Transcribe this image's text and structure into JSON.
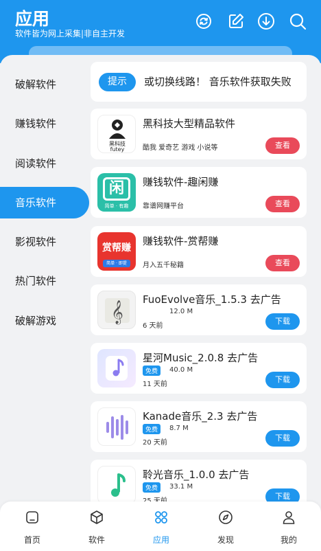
{
  "header": {
    "title": "应用",
    "subtitle": "软件皆为网上采集|非自主开发",
    "icons": [
      "refresh-icon",
      "edit-icon",
      "download-icon",
      "search-icon"
    ]
  },
  "sidebar": {
    "items": [
      {
        "label": "破解软件"
      },
      {
        "label": "赚钱软件"
      },
      {
        "label": "阅读软件"
      },
      {
        "label": "音乐软件",
        "active": true
      },
      {
        "label": "影视软件"
      },
      {
        "label": "热门软件"
      },
      {
        "label": "破解游戏"
      }
    ]
  },
  "tip": {
    "button": "提示",
    "text": "或切换线路！  音乐软件获取失败"
  },
  "promo_cards": [
    {
      "name": "黑科技大型精品软件",
      "desc": "酷我 爱奇艺 游戏 小说等",
      "button": "查看",
      "icon_text": "黑科技",
      "icon_sub": "futey"
    },
    {
      "name": "赚钱软件-趣闲赚",
      "desc": "靠谱网赚平台",
      "button": "查看",
      "icon_text": "闲",
      "icon_sub": "简单 · 有趣"
    },
    {
      "name": "赚钱软件-赏帮赚",
      "desc": "月入五千秘籍",
      "button": "查看",
      "icon_text": "赏帮赚",
      "icon_sub": "简单 · 即提"
    }
  ],
  "app_cards": [
    {
      "name": "FuoEvolve音乐_1.5.3 去广告",
      "size": "12.0 M",
      "age": "6 天前",
      "button": "下载"
    },
    {
      "name": "星河Music_2.0.8 去广告",
      "badge": "免费",
      "size": "40.0 M",
      "age": "11 天前",
      "button": "下载"
    },
    {
      "name": "Kanade音乐_2.3 去广告",
      "badge": "免费",
      "size": "8.7 M",
      "age": "20 天前",
      "button": "下载"
    },
    {
      "name": "聆光音乐_1.0.0 去广告",
      "badge": "免费",
      "size": "33.1 M",
      "age": "25 天前",
      "button": "下载"
    }
  ],
  "tabbar": {
    "tabs": [
      {
        "label": "首页",
        "icon": "home-icon"
      },
      {
        "label": "软件",
        "icon": "cube-icon"
      },
      {
        "label": "应用",
        "icon": "apps-icon",
        "active": true
      },
      {
        "label": "发现",
        "icon": "compass-icon"
      },
      {
        "label": "我的",
        "icon": "user-icon"
      }
    ]
  },
  "colors": {
    "accent": "#1e96ee",
    "view_button": "#e94a5a",
    "download_button": "#1e96ee"
  }
}
